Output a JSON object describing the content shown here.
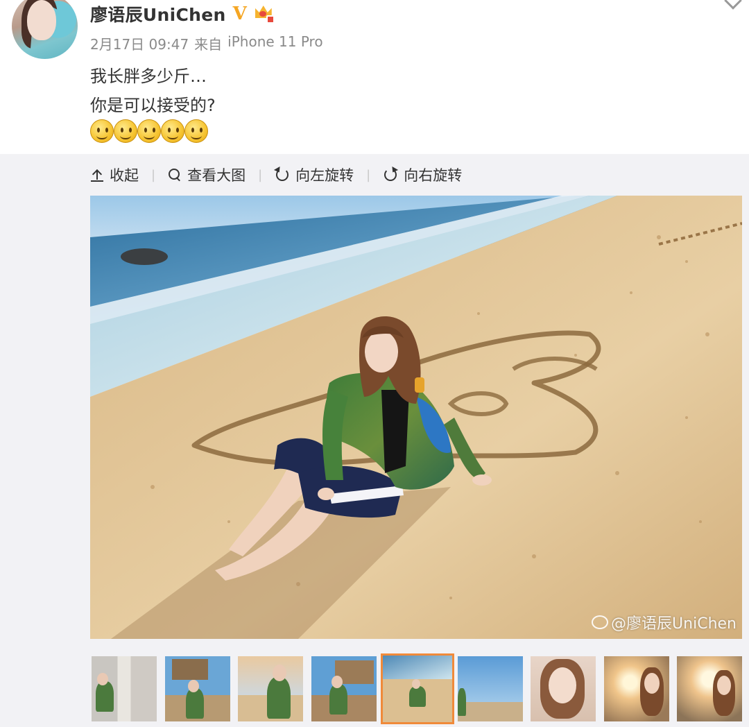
{
  "post": {
    "username": "廖语辰UniChen",
    "verified_mark": "V",
    "date": "2月17日 09:47",
    "source_prefix": "来自",
    "source_device": "iPhone 11 Pro",
    "text_line1": "我长胖多少斤…",
    "text_line2": "你是可以接受的?",
    "emoji_count": 5,
    "emoji_name": "smile-emoji"
  },
  "toolbar": {
    "collapse_label": "收起",
    "view_large_label": "查看大图",
    "rotate_left_label": "向左旋转",
    "rotate_right_label": "向右旋转"
  },
  "photo": {
    "watermark": "@廖语辰UniChen"
  },
  "thumbnails": {
    "count": 9,
    "active_index": 4
  },
  "colors": {
    "verified": "#f5a623",
    "active_thumb_border": "#f08a3a",
    "media_bg": "#f2f2f5"
  }
}
